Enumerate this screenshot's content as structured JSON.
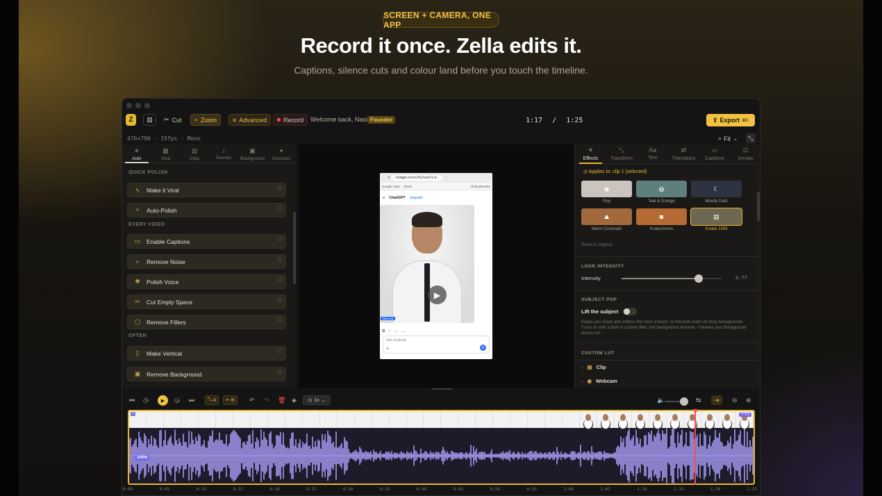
{
  "hero": {
    "badge": "SCREEN + CAMERA, ONE APP",
    "headline": "Record it once. Zella edits it.",
    "subline": "Captions, silence cuts and colour land before you touch the timeline."
  },
  "toolbar": {
    "logo": "Z",
    "cut": "Cut",
    "zoom": "Zoom",
    "advanced": "Advanced",
    "record": "Record",
    "welcome": "Welcome back, Nasir",
    "role": "Founder",
    "current_time": "1:17",
    "separator": "/",
    "total_time": "1:25",
    "export": "Export",
    "export_shortcut": "⌘E",
    "fit": "Fit",
    "meta": "476×790 · 15fps · Mono"
  },
  "left_tabs": [
    {
      "label": "Auto",
      "icon": "wand-icon",
      "glyph": "✧"
    },
    {
      "label": "Viral",
      "icon": "grid-icon",
      "glyph": "▦"
    },
    {
      "label": "Clips",
      "icon": "clips-icon",
      "glyph": "▤"
    },
    {
      "label": "Sounds",
      "icon": "sound-icon",
      "glyph": "♪"
    },
    {
      "label": "Background",
      "icon": "image-icon",
      "glyph": "▣"
    },
    {
      "label": "Assistant",
      "icon": "sparkle-icon",
      "glyph": "✦"
    }
  ],
  "left_sections": {
    "quick": "QUICK POLISH",
    "every": "EVERY VIDEO",
    "often": "OFTEN"
  },
  "actions": {
    "quick": [
      {
        "label": "Make it Viral",
        "glyph": "ϟ"
      },
      {
        "label": "Auto-Polish",
        "glyph": "✧"
      }
    ],
    "every": [
      {
        "label": "Enable Captions",
        "glyph": "▭"
      },
      {
        "label": "Remove Noise",
        "glyph": "≈"
      },
      {
        "label": "Polish Voice",
        "glyph": "✺"
      },
      {
        "label": "Cut Empty Space",
        "glyph": "✂"
      },
      {
        "label": "Remove Fillers",
        "glyph": "▢"
      }
    ],
    "often": [
      {
        "label": "Make Vertical",
        "glyph": "▯"
      },
      {
        "label": "Remove Background",
        "glyph": "▣"
      }
    ]
  },
  "preview": {
    "url": "chatgpt.com/c/6a7eae7a-5...",
    "bookmarks": [
      "Google Suite",
      "Gmail",
      "All Bookmarks"
    ],
    "app_name": "ChatGPT",
    "upgrade": "Upgrade",
    "ask_placeholder": "Ask anything",
    "video_tag": "Tella Link"
  },
  "right_tabs": [
    {
      "label": "Effects",
      "glyph": "✧"
    },
    {
      "label": "Transform",
      "glyph": "⤡"
    },
    {
      "label": "Text",
      "glyph": "Aa"
    },
    {
      "label": "Transitions",
      "glyph": "⇄"
    },
    {
      "label": "Captions",
      "glyph": "▭"
    },
    {
      "label": "Arrows",
      "glyph": "⊡"
    }
  ],
  "effects": {
    "applies": "Applies to: clip 1 (selected)",
    "looks": [
      {
        "label": "Pop",
        "glyph": "◉",
        "bg": "#c9c4bd",
        "selected": false
      },
      {
        "label": "Teal & Orange",
        "glyph": "◍",
        "bg": "#5f7f7c",
        "selected": false
      },
      {
        "label": "Moody Dark",
        "glyph": "☾",
        "bg": "#2d3340",
        "selected": false
      },
      {
        "label": "Warm Cinematic",
        "glyph": "⛰",
        "bg": "#a26a3c",
        "selected": false
      },
      {
        "label": "Kodachrome",
        "glyph": "◙",
        "bg": "#b66a34",
        "selected": false
      },
      {
        "label": "Kodak 2383",
        "glyph": "▤",
        "bg": "#6e6752",
        "selected": true
      }
    ],
    "reset": "Reset to Original",
    "look_intensity_title": "LOOK INTENSITY",
    "intensity_label": "Intensity",
    "intensity_value": "0.77",
    "intensity_fraction": 0.77,
    "subject_pop_title": "SUBJECT POP",
    "lift_label": "Lift the subject",
    "lift_note": "Keeps you sharp and softens the room a touch, so the look reads on busy backgrounds. Turns on with a look or custom filter. Not background removal - it leaves your Background choice too.",
    "custom_lut_title": "CUSTOM LUT",
    "lut_rows": [
      "Clip",
      "Webcam"
    ]
  },
  "timeline": {
    "speed": "1x",
    "a_label": "A",
    "b_label": "B",
    "track_id": "1",
    "clip_badge": "100%",
    "fx_badge": "+ Fx",
    "playhead_fraction": 0.9059,
    "ruler": [
      "0:00",
      "0:05",
      "0:10",
      "0:15",
      "0:20",
      "0:25",
      "0:30",
      "0:35",
      "0:40",
      "0:45",
      "0:50",
      "0:55",
      "1:00",
      "1:05",
      "1:10",
      "1:15",
      "1:20",
      "1:25"
    ]
  },
  "colors": {
    "accent": "#e6b931",
    "waveform": "#a79bf2",
    "playhead": "#ff4b4b"
  }
}
